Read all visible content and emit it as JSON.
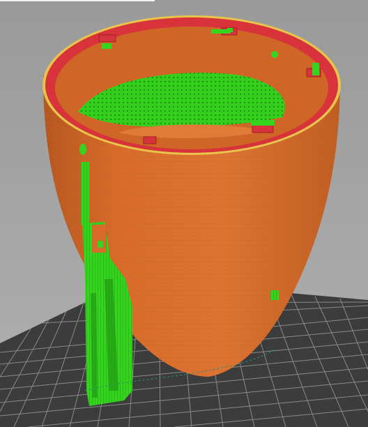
{
  "viewport": {
    "title": "",
    "object": "slicer-preview-vase",
    "colors": {
      "background": "#a6a6a6",
      "bed_fill": "#3c3c3c",
      "bed_grid": "#8a8a8a",
      "shell": "#d86b2a",
      "shell_dark": "#b4561f",
      "rim_top": "#d8323a",
      "rim_edge": "#e8c44a",
      "support": "#35d41e",
      "support_dark": "#1e8f12"
    },
    "legend_items": []
  }
}
